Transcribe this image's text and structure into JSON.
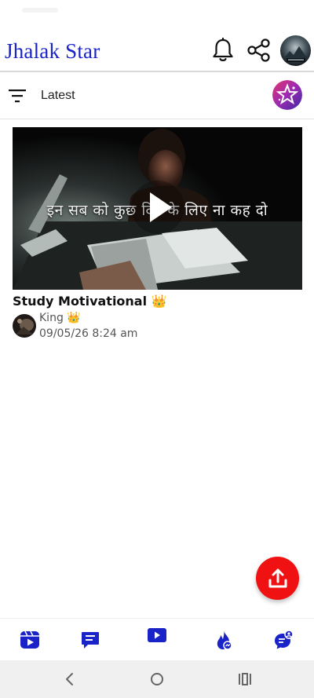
{
  "header": {
    "app_title": "Jhalak Star",
    "icons": [
      "bell-icon",
      "share-icon",
      "profile-avatar"
    ]
  },
  "filter": {
    "label": "Latest",
    "icon": "sort-filter-icon",
    "badge_icon": "star-logo"
  },
  "feed": {
    "items": [
      {
        "thumbnail_caption": "इन सब को कुछ दिन के लिए ना कह दो",
        "title": "Study Motivational 👑",
        "author": "King 👑",
        "timestamp": "09/05/26 8:24 am"
      }
    ]
  },
  "fab": {
    "icon": "upload-icon"
  },
  "bottom_nav": {
    "items": [
      "reels-icon",
      "chat-icon",
      "video-icon",
      "trending-fire-icon",
      "support-chat-icon"
    ]
  },
  "colors": {
    "brand_blue": "#1a23c8",
    "fab_red": "#f01212",
    "nav_blue": "#1a23c8"
  }
}
